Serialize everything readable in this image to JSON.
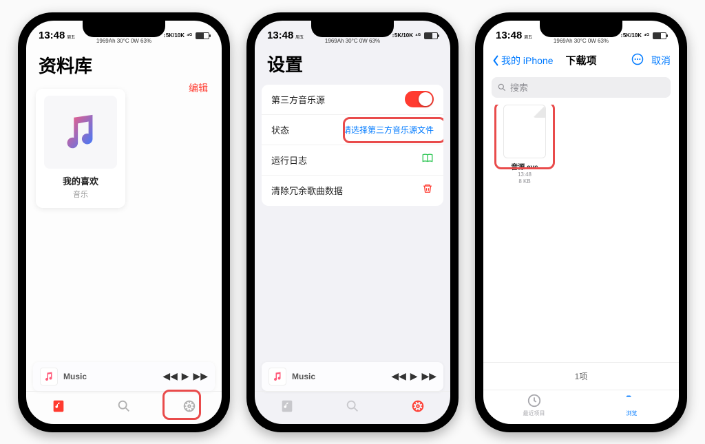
{
  "status": {
    "time": "13:48",
    "day": "周五",
    "mid": "1969Ah  30°C  0W  63%",
    "sig": "⁴ᴳ",
    "sim": "↕5K/10K"
  },
  "phone1": {
    "title": "资料库",
    "edit": "编辑",
    "card": {
      "title": "我的喜欢",
      "sub": "音乐"
    },
    "np": {
      "title": "Music"
    }
  },
  "phone2": {
    "title": "设置",
    "rows": {
      "src": "第三方音乐源",
      "state": "状态",
      "state_action": "请选择第三方音乐源文件",
      "log": "运行日志",
      "clean": "清除冗余歌曲数据"
    },
    "np": {
      "title": "Music"
    }
  },
  "phone3": {
    "back": "我的 iPhone",
    "title": "下载项",
    "cancel": "取消",
    "search": "搜索",
    "file": {
      "name": "音源.evc",
      "time": "13:48",
      "size": "8 KB"
    },
    "footer": "1项",
    "tabs": {
      "recent": "最近项目",
      "browse": "浏览"
    }
  }
}
